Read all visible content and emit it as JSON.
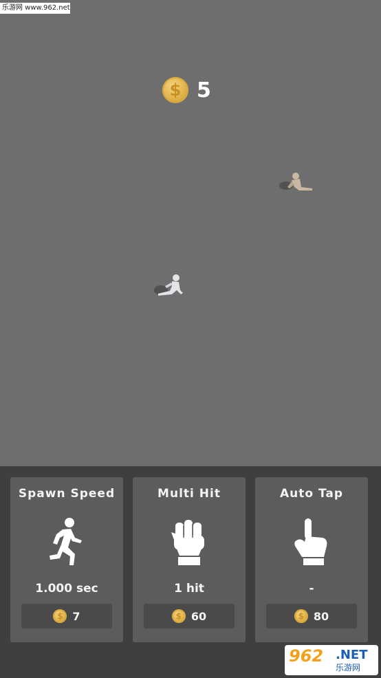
{
  "watermark_top": "乐游网 www.962.net",
  "hud": {
    "coins": "5",
    "coin_icon": "dollar-coin"
  },
  "upgrades": [
    {
      "title": "Spawn Speed",
      "icon": "running-person",
      "stat": "1.000 sec",
      "price": "7"
    },
    {
      "title": "Multi Hit",
      "icon": "fist",
      "stat": "1 hit",
      "price": "60"
    },
    {
      "title": "Auto Tap",
      "icon": "pointing-hand",
      "stat": "-",
      "price": "80"
    }
  ],
  "logo": {
    "num": "962",
    "net": ".NET",
    "cn": "乐游网"
  },
  "colors": {
    "field": "#6e6e6e",
    "panel": "#3f3f3f",
    "card": "#5c5c5c",
    "button": "#4a4a4a",
    "coin": "#e0b24a"
  }
}
